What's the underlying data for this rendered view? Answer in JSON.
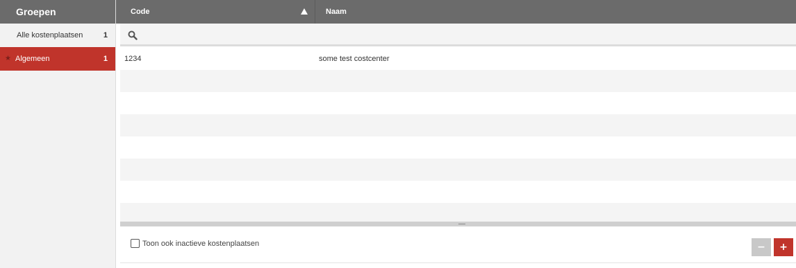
{
  "sidebar": {
    "title": "Groepen",
    "groups": [
      {
        "label": "Alle kostenplaatsen",
        "count": "1",
        "selected": false
      },
      {
        "label": "Algemeen",
        "count": "1",
        "selected": true,
        "icon": "star-icon"
      }
    ]
  },
  "grid": {
    "columns": [
      {
        "label": "Code",
        "sort": "ascending"
      },
      {
        "label": "Naam"
      }
    ],
    "rows": [
      {
        "code": "1234",
        "name": "some test costcenter"
      },
      {
        "code": "",
        "name": ""
      },
      {
        "code": "",
        "name": ""
      },
      {
        "code": "",
        "name": ""
      },
      {
        "code": "",
        "name": ""
      },
      {
        "code": "",
        "name": ""
      },
      {
        "code": "",
        "name": ""
      },
      {
        "code": "",
        "name": ""
      }
    ]
  },
  "footer": {
    "show_inactive_label": "Toon ook inactieve kostenplaatsen",
    "show_inactive_checked": false,
    "remove_label": "−",
    "add_label": "+"
  },
  "colors": {
    "header_bg": "#6b6b6b",
    "accent": "#c0342b",
    "sidebar_bg": "#f2f2f2"
  }
}
